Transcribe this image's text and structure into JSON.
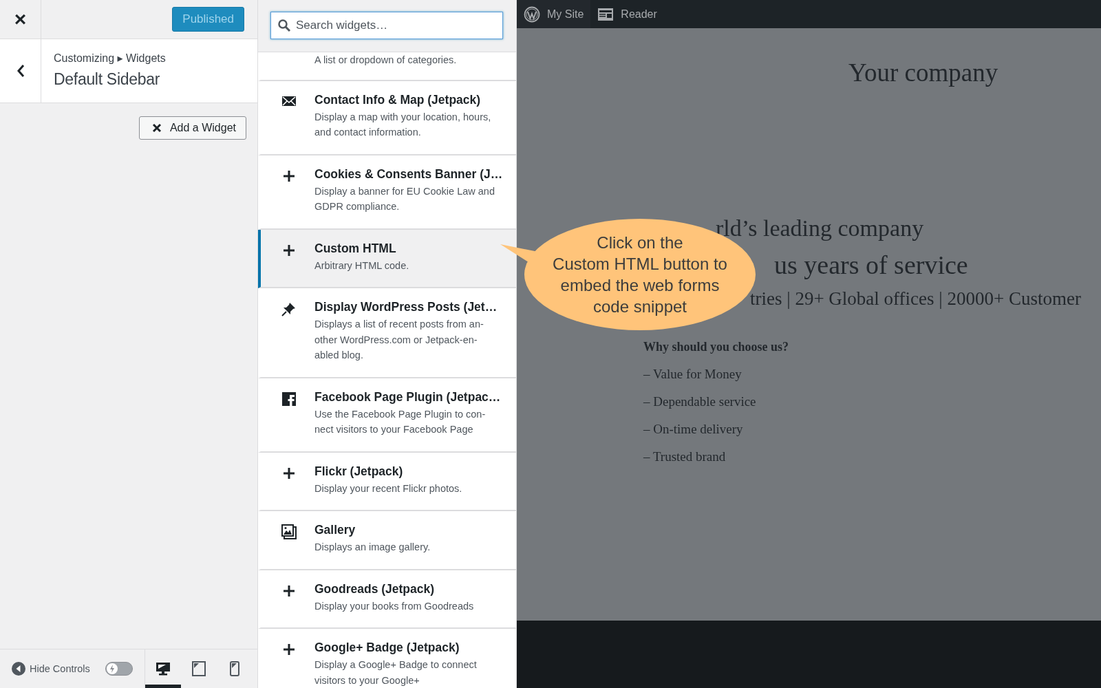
{
  "customizer": {
    "close_label": "×",
    "publish_button": {
      "label": "Published",
      "disabled": true
    },
    "breadcrumb": "Customizing ▸ Widgets",
    "section_title": "Default Sidebar",
    "add_widget_button": {
      "label": "Add a Widget"
    },
    "footer": {
      "hide_controls": "Hide Controls",
      "toggle_on": false,
      "devices": [
        {
          "kind": "desktop",
          "selected": true
        },
        {
          "kind": "tablet",
          "selected": false
        },
        {
          "kind": "mobile",
          "selected": false
        }
      ]
    }
  },
  "widget_picker": {
    "search": {
      "placeholder": "Search widgets…",
      "focused": true
    },
    "widgets": [
      {
        "kind": "cut",
        "description": "A list or dropdown of categories.",
        "selected": false
      },
      {
        "kind": "envelope",
        "title": "Contact Info & Map (Jetpack)",
        "description": "Display a map with your location, hours, and contact information.",
        "selected": false
      },
      {
        "kind": "plus",
        "title": "Cookies & Consents Banner (J…",
        "description": "Display a banner for EU Cookie Law and GDPR compliance.",
        "selected": false
      },
      {
        "kind": "plus",
        "title": "Custom HTML",
        "description": "Arbitrary HTML code.",
        "selected": true
      },
      {
        "kind": "pin",
        "title": "Display WordPress Posts (Jet…",
        "description": "Displays a list of recent posts from an-other WordPress.com or Jetpack-en-abled blog.",
        "selected": false
      },
      {
        "kind": "square",
        "title": "Facebook Page Plugin (Jetpac…",
        "description": "Use the Facebook Page Plugin to con-nect visitors to your Facebook Page",
        "selected": false
      },
      {
        "kind": "plus",
        "title": "Flickr (Jetpack)",
        "description": "Display your recent Flickr photos.",
        "selected": false
      },
      {
        "kind": "gallery",
        "title": "Gallery",
        "description": "Displays an image gallery.",
        "selected": false
      },
      {
        "kind": "plus",
        "title": "Goodreads (Jetpack)",
        "description": "Display your books from Goodreads",
        "selected": false
      },
      {
        "kind": "plus",
        "title": "Google+ Badge (Jetpack)",
        "description": "Display a Google+ Badge to connect visitors to your Google+",
        "selected": false
      }
    ]
  },
  "preview": {
    "top_bar": [
      {
        "kind": "site",
        "label": "My Site"
      },
      {
        "kind": "reader",
        "label": "Reader"
      }
    ],
    "site_title": "Your company",
    "headline_lines": [
      "rld’s leading company",
      "us years of service",
      "tries | 29+ Global offices | 20000+ Customer"
    ],
    "section_heading": "Why should you choose us?",
    "bullets": [
      "– Value for Money",
      "– Dependable service",
      "– On-time delivery",
      "– Trusted brand"
    ]
  },
  "callout": {
    "lines": [
      "Click on the",
      "Custom HTML button to",
      "embed the web forms",
      "code snippet"
    ]
  }
}
